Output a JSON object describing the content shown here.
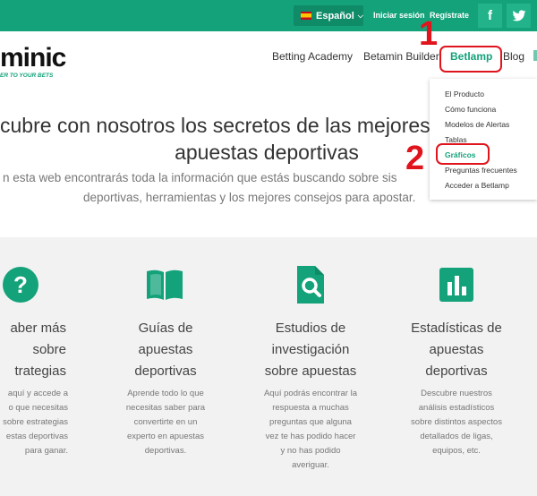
{
  "topbar": {
    "language": "Español",
    "login": "Iniciar sesión",
    "register": "Regístrate",
    "social": [
      "facebook-icon",
      "twitter-icon"
    ]
  },
  "brand": {
    "logo_text": "minic",
    "tagline": "ER TO YOUR BETS"
  },
  "nav": {
    "items": [
      "Betting Academy",
      "Betamin Builder",
      "Betlamp",
      "Blog"
    ],
    "active": "Betlamp"
  },
  "dropdown": {
    "items": [
      "El Producto",
      "Cómo funciona",
      "Modelos de Alertas",
      "Tablas",
      "Gráficos",
      "Preguntas frecuentes",
      "Acceder a Betlamp"
    ],
    "active": "Gráficos"
  },
  "annotations": {
    "num1": "1",
    "num2": "2",
    "color": "#e0141c"
  },
  "hero": {
    "title_line1": "cubre con nosotros los secretos de las mejores e",
    "title_line2": "apuestas deportivas",
    "sub_line1": "n esta web encontrarás toda la información que estás buscando sobre sis",
    "sub_line2": "deportivas, herramientas y los mejores consejos para apostar."
  },
  "features": [
    {
      "icon": "question-icon",
      "title": [
        "aber más",
        "sobre",
        "trategias"
      ],
      "desc": [
        "aquí y accede a",
        "o que necesitas",
        "sobre estrategias",
        "estas deportivas",
        "para ganar."
      ]
    },
    {
      "icon": "book-icon",
      "title": [
        "Guías de",
        "apuestas",
        "deportivas"
      ],
      "desc": [
        "Aprende todo lo que",
        "necesitas saber para",
        "convertirte en un",
        "experto en apuestas",
        "deportivas."
      ]
    },
    {
      "icon": "document-search-icon",
      "title": [
        "Estudios de",
        "investigación",
        "sobre apuestas"
      ],
      "desc": [
        "Aquí podrás encontrar la",
        "respuesta a muchas",
        "preguntas que alguna",
        "vez te has podido hacer",
        "y no has podido",
        "averiguar."
      ]
    },
    {
      "icon": "bar-chart-icon",
      "title": [
        "Estadísticas de",
        "apuestas",
        "deportivas"
      ],
      "desc": [
        "Descubre nuestros",
        "análisis estadísticos",
        "sobre distintos aspectos",
        "detallados de ligas,",
        "equipos, etc."
      ]
    }
  ],
  "colors": {
    "brand_green": "#13a27a",
    "accent_red": "#e0141c"
  }
}
